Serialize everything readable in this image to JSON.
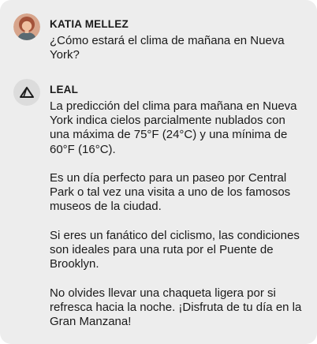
{
  "conversation": {
    "user": {
      "name": "KATIA MELLEZ",
      "avatar_icon": "user-photo-avatar",
      "message": "¿Cómo estará el clima de mañana en Nueva York?"
    },
    "assistant": {
      "name": "LEAL",
      "avatar_icon": "triangle-logo-icon",
      "paragraphs": [
        "La predicción del clima para mañana en Nueva York indica cielos parcialmente nublados con una máxima de 75°F (24°C) y una mínima de 60°F (16°C).",
        "Es un día perfecto para un paseo por Central Park o tal vez una visita a uno de los famosos museos de la ciudad.",
        "Si eres un fanático del ciclismo, las condiciones son ideales para una ruta por el Puente de Brooklyn.",
        "No olvides llevar una chaqueta ligera por si refresca hacia la noche. ¡Disfruta de tu día en la Gran Manzana!"
      ]
    }
  },
  "colors": {
    "card_background": "#ededed",
    "text": "#1a1a1a",
    "logo_background": "#dcdcdc"
  }
}
